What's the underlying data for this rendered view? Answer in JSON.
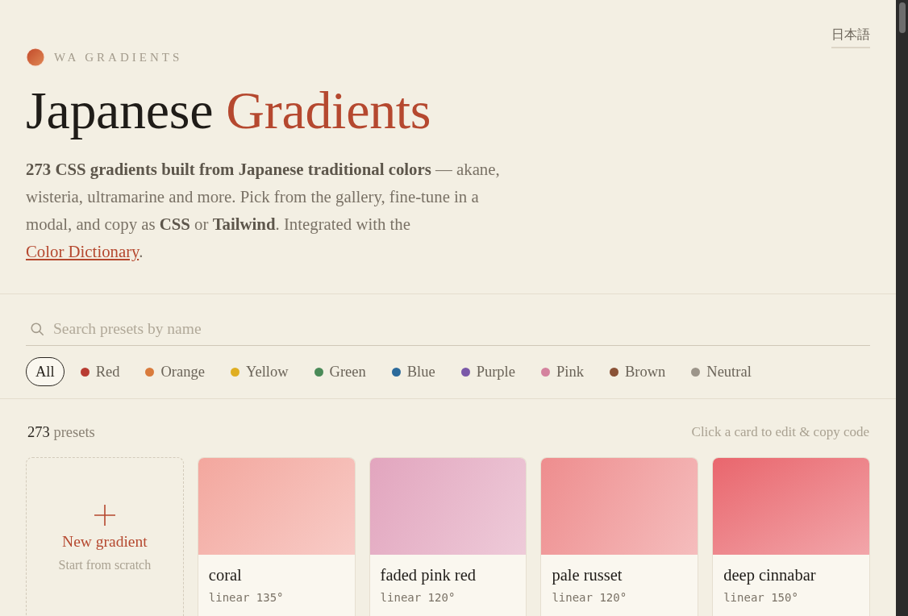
{
  "header": {
    "brand": "WA GRADIENTS",
    "language_link": "日本語",
    "title": "Japanese",
    "title_accent": "Gradients",
    "description": {
      "text": "**273 CSS gradients built from Japanese traditional colors** — akane, wisteria, ultramarine and more. Pick from the gallery, fine-tune in a modal, and copy as **CSS** or **Tailwind**. Integrated with the ",
      "link": "Color Dictionary",
      "end": "."
    }
  },
  "search": {
    "placeholder": "Search presets by name"
  },
  "filters": [
    {
      "kind": "all",
      "label": "All",
      "selected": true
    },
    {
      "kind": "color",
      "label": "Red",
      "selected": false,
      "color": "#b83c32"
    },
    {
      "kind": "color",
      "label": "Orange",
      "selected": false,
      "color": "#d97b3c"
    },
    {
      "kind": "color",
      "label": "Yellow",
      "selected": false,
      "color": "#dfae22"
    },
    {
      "kind": "color",
      "label": "Green",
      "selected": false,
      "color": "#4a8a58"
    },
    {
      "kind": "color",
      "label": "Blue",
      "selected": false,
      "color": "#2b6a9b"
    },
    {
      "kind": "color",
      "label": "Purple",
      "selected": false,
      "color": "#7a58a8"
    },
    {
      "kind": "color",
      "label": "Pink",
      "selected": false,
      "color": "#d4829e"
    },
    {
      "kind": "color",
      "label": "Brown",
      "selected": false,
      "color": "#8a5236"
    },
    {
      "kind": "color",
      "label": "Neutral",
      "selected": false,
      "color": "#9c958a"
    }
  ],
  "gallery": {
    "count": "273",
    "count_label": "presets",
    "hint": "Click a card to edit & copy code",
    "new_card": {
      "title": "New gradient",
      "subtitle": "Start from scratch"
    },
    "cards": [
      {
        "name": "coral",
        "gradient": "linear 135°",
        "color": "#f3a79e"
      },
      {
        "name": "faded pink red",
        "gradient": "linear 120°",
        "color": "#e2a5be"
      },
      {
        "name": "pale russet",
        "gradient": "linear 120°",
        "color": "#ee8d8e"
      },
      {
        "name": "deep cinnabar",
        "gradient": "linear 150°",
        "color": "#e9666d"
      }
    ]
  }
}
